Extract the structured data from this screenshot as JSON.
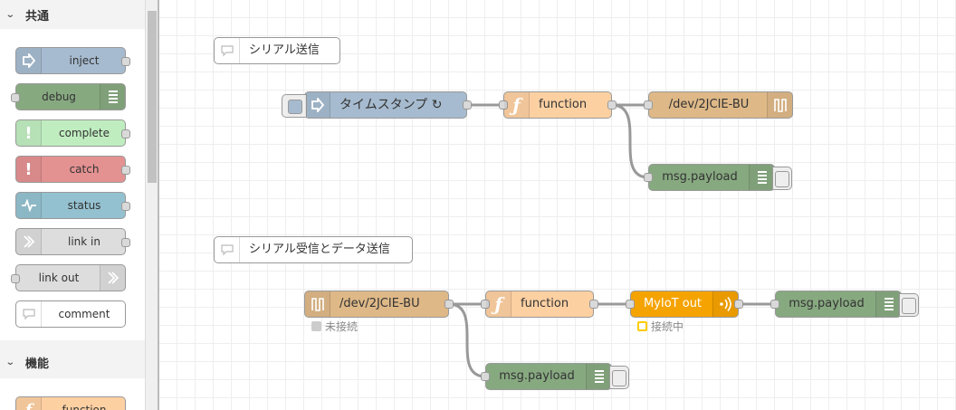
{
  "palette": {
    "categories": [
      {
        "label": "共通",
        "chevron": "⌄"
      },
      {
        "label": "機能",
        "chevron": "⌄"
      }
    ],
    "nodes": [
      {
        "label": "inject",
        "color": "#a6bbcf",
        "icon": "inject-icon"
      },
      {
        "label": "debug",
        "color": "#87a980",
        "icon": "debug-icon"
      },
      {
        "label": "complete",
        "color": "#c0edc0",
        "icon": "alert-icon"
      },
      {
        "label": "catch",
        "color": "#e49191",
        "icon": "alert-icon"
      },
      {
        "label": "status",
        "color": "#94c1d0",
        "icon": "status-icon"
      },
      {
        "label": "link in",
        "color": "#dddddd",
        "icon": "link-icon"
      },
      {
        "label": "link out",
        "color": "#dddddd",
        "icon": "link-icon"
      },
      {
        "label": "comment",
        "color": "#ffffff",
        "icon": "comment-icon"
      },
      {
        "label": "function",
        "color": "#fdd0a2",
        "icon": "function-icon"
      }
    ]
  },
  "flow": {
    "comment1": "シリアル送信",
    "inject_label": "タイムスタンプ ↻",
    "function1": "function",
    "serial_out": "/dev/2JCIE-BU",
    "debug1": "msg.payload",
    "comment2": "シリアル受信とデータ送信",
    "serial_in": "/dev/2JCIE-BU",
    "serial_in_status": "未接続",
    "function2": "function",
    "myiot": "MyIoT out",
    "myiot_status": "接続中",
    "debug2": "msg.payload",
    "debug3": "msg.payload"
  },
  "colors": {
    "inject": "#a6bbcf",
    "function": "#fdd0a2",
    "serial": "#deb887",
    "debug": "#87a980",
    "myiot": "#f5a300",
    "status_gray": "#cccccc",
    "status_yellow": "#ffcc00"
  }
}
